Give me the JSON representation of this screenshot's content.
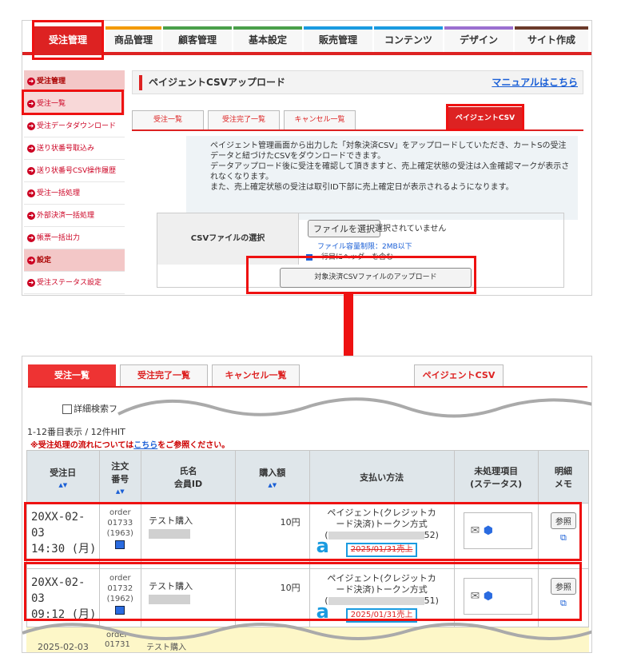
{
  "top": {
    "nav": [
      "受注管理",
      "商品管理",
      "顧客管理",
      "基本設定",
      "販売管理",
      "コンテンツ",
      "デザイン",
      "サイト作成"
    ],
    "nav_colors": [
      "#d22",
      "#f39a00",
      "#4aa04a",
      "#4aa04a",
      "#1a9be0",
      "#1a9be0",
      "#9b6fd0",
      "#6b3a2a"
    ],
    "sidebar": [
      {
        "label": "受注管理",
        "type": "head"
      },
      {
        "label": "受注一覧",
        "type": "sel"
      },
      {
        "label": "受注データダウンロード",
        "type": "item"
      },
      {
        "label": "送り状番号取込み",
        "type": "item"
      },
      {
        "label": "送り状番号CSV操作履歴",
        "type": "item"
      },
      {
        "label": "受注一括処理",
        "type": "item"
      },
      {
        "label": "外部決済一括処理",
        "type": "item"
      },
      {
        "label": "帳票一括出力",
        "type": "item"
      },
      {
        "label": "設定",
        "type": "head"
      },
      {
        "label": "受注ステータス設定",
        "type": "item"
      }
    ],
    "title": "ペイジェントCSVアップロード",
    "manual_link": "マニュアルはこちら",
    "subtabs": [
      "受注一覧",
      "受注完了一覧",
      "キャンセル一覧",
      "ペイジェントCSV"
    ],
    "info": [
      "ペイジェント管理画面から出力した「対象決済CSV」をアップロードしていただき、カートSの受注",
      "データと紐づけたCSVをダウンロードできます。",
      "データアップロード後に受注を確認して頂きますと、売上確定状態の受注は入金確認マークが表示さ",
      "れなくなります。",
      "また、売上確定状態の受注は取引ID下部に売上確定日が表示されるようになります。"
    ],
    "csv_label": "CSVファイルの選択",
    "file_button": "ファイルを選択",
    "file_status": "選択されていません",
    "file_limit": "ファイル容量制限：2MB以下",
    "header_checkbox": "一行目にヘッダーを含む",
    "upload_button": "対象決済CSVファイルのアップロード"
  },
  "bottom": {
    "tabs": [
      "受注一覧",
      "受注完了一覧",
      "キャンセル一覧",
      "ペイジェントCSV"
    ],
    "search_label": "詳細検索フ",
    "hit_text": "1-12番目表示 / 12件HIT",
    "note_prefix": "※受注処理の流れについては",
    "note_link": "こちら",
    "note_suffix": "をご参照ください。",
    "headers": {
      "date": "受注日",
      "order_no_1": "注文",
      "order_no_2": "番号",
      "name_1": "氏名",
      "name_2": "会員ID",
      "amount": "購入額",
      "payment": "支払い方法",
      "status_1": "未処理項目",
      "status_2": "(ステータス)",
      "memo_1": "明細",
      "memo_2": "メモ",
      "sort": "▲▼"
    },
    "rows": [
      {
        "date1": "20XX-02-03",
        "date2": "14:30 (月)",
        "order": "order",
        "no": "01733",
        "sub": "(1963)",
        "name": "テスト購入",
        "amount": "10円",
        "pay1": "ペイジェント(クレジットカ",
        "pay2": "ード決済)トークン方式",
        "pay3": "52)",
        "sale": "2025/01/31売上",
        "ref": "参照"
      },
      {
        "date1": "20XX-02-03",
        "date2": "09:12 (月)",
        "order": "order",
        "no": "01732",
        "sub": "(1962)",
        "name": "テスト購入",
        "amount": "10円",
        "pay1": "ペイジェント(クレジットカ",
        "pay2": "ード決済)トークン方式",
        "pay3": "51)",
        "sale": "2025/01/31売上",
        "ref": "参照"
      }
    ],
    "partial_row": {
      "date": "2025-02-03",
      "order": "order",
      "no": "01731",
      "name": "テスト購入"
    }
  }
}
